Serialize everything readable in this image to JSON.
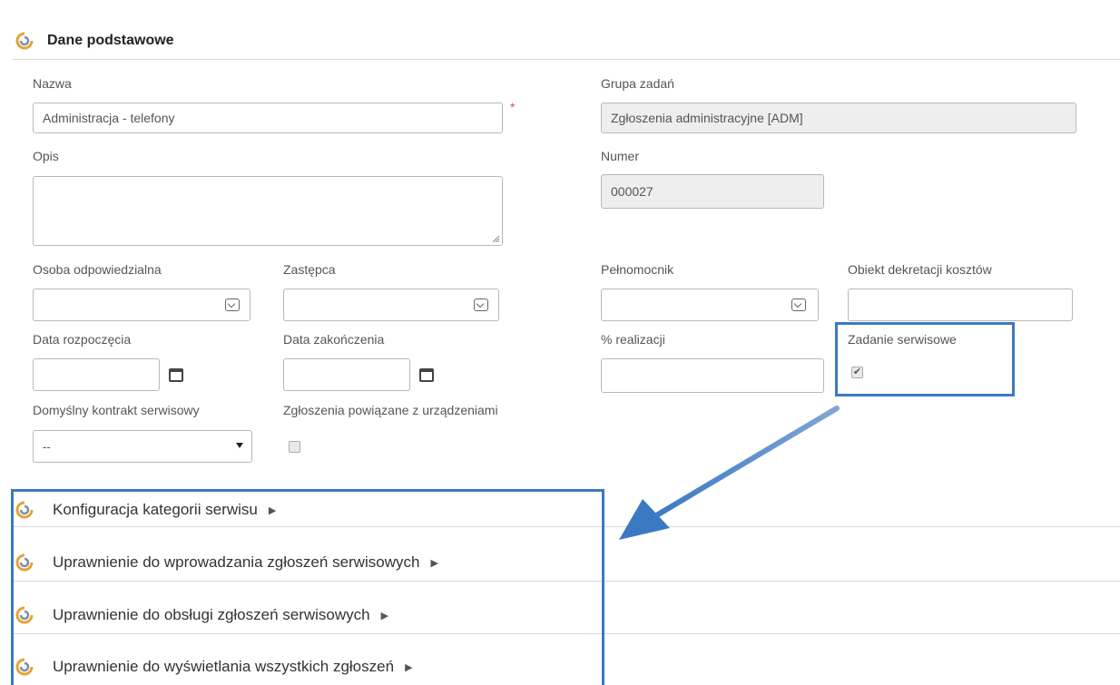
{
  "main_section": {
    "title": "Dane podstawowe"
  },
  "form": {
    "nazwa": {
      "label": "Nazwa",
      "value": "Administracja - telefony",
      "required_mark": "*"
    },
    "grupa_zadan": {
      "label": "Grupa zadań",
      "value": "Zgłoszenia administracyjne [ADM]"
    },
    "opis": {
      "label": "Opis",
      "value": ""
    },
    "numer": {
      "label": "Numer",
      "value": "000027"
    },
    "osoba_odpowiedzialna": {
      "label": "Osoba odpowiedzialna",
      "value": ""
    },
    "zastepca": {
      "label": "Zastępca",
      "value": ""
    },
    "pelnomocnik": {
      "label": "Pełnomocnik",
      "value": ""
    },
    "obiekt_dekretacji": {
      "label": "Obiekt dekretacji kosztów",
      "value": ""
    },
    "data_rozpoczecia": {
      "label": "Data rozpoczęcia",
      "value": ""
    },
    "data_zakonczenia": {
      "label": "Data zakończenia",
      "value": ""
    },
    "realizacja": {
      "label": "% realizacji",
      "value": ""
    },
    "zadanie_serwisowe": {
      "label": "Zadanie serwisowe",
      "checked": true,
      "check_mark": "✔"
    },
    "domyslny_kontrakt": {
      "label": "Domyślny kontrakt serwisowy",
      "value": "--"
    },
    "zgloszenia_powiazane": {
      "label": "Zgłoszenia powiązane z urządzeniami",
      "checked": false
    }
  },
  "subsections": [
    {
      "title": "Konfiguracja kategorii serwisu",
      "arrow": "▶"
    },
    {
      "title": "Uprawnienie do wprowadzania zgłoszeń serwisowych",
      "arrow": "▶"
    },
    {
      "title": "Uprawnienie do obsługi zgłoszeń serwisowych",
      "arrow": "▶"
    },
    {
      "title": "Uprawnienie do wyświetlania wszystkich zgłoszeń",
      "arrow": "▶"
    }
  ],
  "colors": {
    "highlight": "#3b79c2",
    "readonly_bg": "#eeeeee",
    "required": "#d9534f"
  }
}
